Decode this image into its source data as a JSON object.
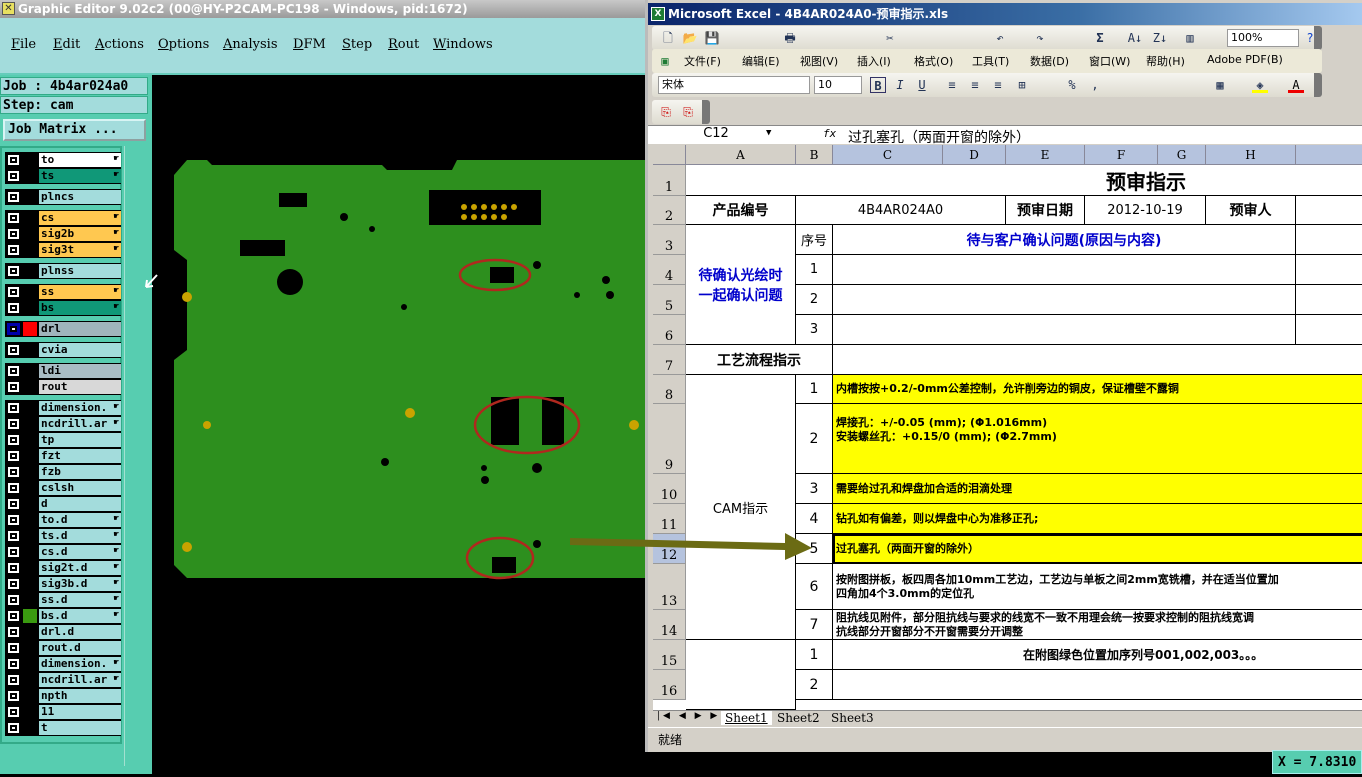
{
  "graphic_editor": {
    "title": "Graphic Editor 9.02c2 (00@HY-P2CAM-PC198 - Windows, pid:1672)",
    "menu": [
      "File",
      "Edit",
      "Actions",
      "Options",
      "Analysis",
      "DFM",
      "Step",
      "Rout",
      "Windows"
    ],
    "job": "Job : 4b4ar024a0",
    "step": "Step: cam",
    "job_matrix": "Job Matrix ...",
    "layers": [
      {
        "name": "to",
        "color": "#ffffff",
        "edit": true
      },
      {
        "name": "ts",
        "color": "#109878",
        "edit": true
      },
      {
        "name": "plncs",
        "color": "#a3dcdc",
        "edit": false
      },
      {
        "name": "cs",
        "color": "#ffc850",
        "edit": true
      },
      {
        "name": "sig2b",
        "color": "#ffc850",
        "edit": true
      },
      {
        "name": "sig3t",
        "color": "#ffc850",
        "edit": true
      },
      {
        "name": "plnss",
        "color": "#a3dcdc",
        "edit": false
      },
      {
        "name": "ss",
        "color": "#ffc850",
        "edit": true
      },
      {
        "name": "bs",
        "color": "#109878",
        "edit": true
      },
      {
        "name": "drl",
        "color": "#a0b4bc",
        "edit": false,
        "active": true
      },
      {
        "name": "cvia",
        "color": "#a3dcdc",
        "edit": false
      },
      {
        "name": "ldi",
        "color": "#a8bcc4",
        "edit": false
      },
      {
        "name": "rout",
        "color": "#d8d8d8",
        "edit": false
      },
      {
        "name": "dimension.",
        "color": "#a3dcdc",
        "edit": true
      },
      {
        "name": "ncdrill.ar",
        "color": "#a3dcdc",
        "edit": true
      },
      {
        "name": "tp",
        "color": "#a3dcdc",
        "edit": false
      },
      {
        "name": "fzt",
        "color": "#a3dcdc",
        "edit": false
      },
      {
        "name": "fzb",
        "color": "#a3dcdc",
        "edit": false
      },
      {
        "name": "cslsh",
        "color": "#a3dcdc",
        "edit": false
      },
      {
        "name": "d",
        "color": "#a3dcdc",
        "edit": false
      },
      {
        "name": "to.d",
        "color": "#a3dcdc",
        "edit": true
      },
      {
        "name": "ts.d",
        "color": "#a3dcdc",
        "edit": true
      },
      {
        "name": "cs.d",
        "color": "#a3dcdc",
        "edit": true
      },
      {
        "name": "sig2t.d",
        "color": "#a3dcdc",
        "edit": true
      },
      {
        "name": "sig3b.d",
        "color": "#a3dcdc",
        "edit": true
      },
      {
        "name": "ss.d",
        "color": "#a3dcdc",
        "edit": true
      },
      {
        "name": "bs.d",
        "color": "#a3dcdc",
        "edit": true,
        "affected": true
      },
      {
        "name": "drl.d",
        "color": "#a3dcdc",
        "edit": false
      },
      {
        "name": "rout.d",
        "color": "#a3dcdc",
        "edit": false
      },
      {
        "name": "dimension.",
        "color": "#a3dcdc",
        "edit": true
      },
      {
        "name": "ncdrill.ar",
        "color": "#a3dcdc",
        "edit": true
      },
      {
        "name": "npth",
        "color": "#a3dcdc",
        "edit": false
      },
      {
        "name": "11",
        "color": "#a3dcdc",
        "edit": false
      },
      {
        "name": "t",
        "color": "#a3dcdc",
        "edit": false
      }
    ],
    "coord_readout": "X = 7.8310"
  },
  "excel": {
    "title": "Microsoft Excel - 4B4AR024A0-预审指示.xls",
    "menu": [
      "文件(F)",
      "编辑(E)",
      "视图(V)",
      "插入(I)",
      "格式(O)",
      "工具(T)",
      "数据(D)",
      "窗口(W)",
      "帮助(H)",
      "Adobe PDF(B)"
    ],
    "font": "宋体",
    "font_size": "10",
    "zoom": "100%",
    "name_box": "C12",
    "formula": "过孔塞孔（两面开窗的除外）",
    "columns": [
      "A",
      "B",
      "C",
      "D",
      "E",
      "F",
      "G",
      "H"
    ],
    "rows": [
      "1",
      "2",
      "3",
      "4",
      "5",
      "6",
      "7",
      "8",
      "9",
      "10",
      "11",
      "12",
      "13",
      "14",
      "15",
      "16"
    ],
    "cells": {
      "title": "预审指示",
      "product_no_label": "产品编号",
      "product_no": "4B4AR024A0",
      "review_date_label": "预审日期",
      "review_date": "2012-10-19",
      "reviewer_label": "预审人",
      "confirm_label": "待确认光绘时一起确认问题",
      "seq_label": "序号",
      "confirm_header": "待与客户确认问题(原因与内容)",
      "process_label": "工艺流程指示",
      "cam_label": "CAM指示",
      "cam_items": [
        "内槽按按+0.2/-0mm公差控制，允许削旁边的铜皮，保证槽壁不露铜",
        "焊接孔：+/-0.05 (mm); (Φ1.016mm)\n安装螺丝孔：+0.15/0 (mm); (Φ2.7mm)",
        "需要给过孔和焊盘加合适的泪滴处理",
        "钻孔如有偏差，则以焊盘中心为准移正孔;",
        "过孔塞孔（两面开窗的除外）",
        "按附图拼板，板四周各加10mm工艺边，工艺边与单板之间2mm宽铣槽，并在适当位置加\n四角加4个3.0mm的定位孔",
        "阻抗线见附件，部分阻抗线与要求的线宽不一致不用理会统一按要求控制的阻抗线宽调\n抗线部分开窗部分不开窗需要分开调整"
      ],
      "row15_text": "在附图绿色位置加序列号001,002,003。。。",
      "nums": [
        "1",
        "2",
        "3",
        "4",
        "5",
        "6",
        "7"
      ]
    },
    "sheets": [
      "Sheet1",
      "Sheet2",
      "Sheet3"
    ],
    "status": "就绪",
    "highlight_color": "#ffff00"
  }
}
